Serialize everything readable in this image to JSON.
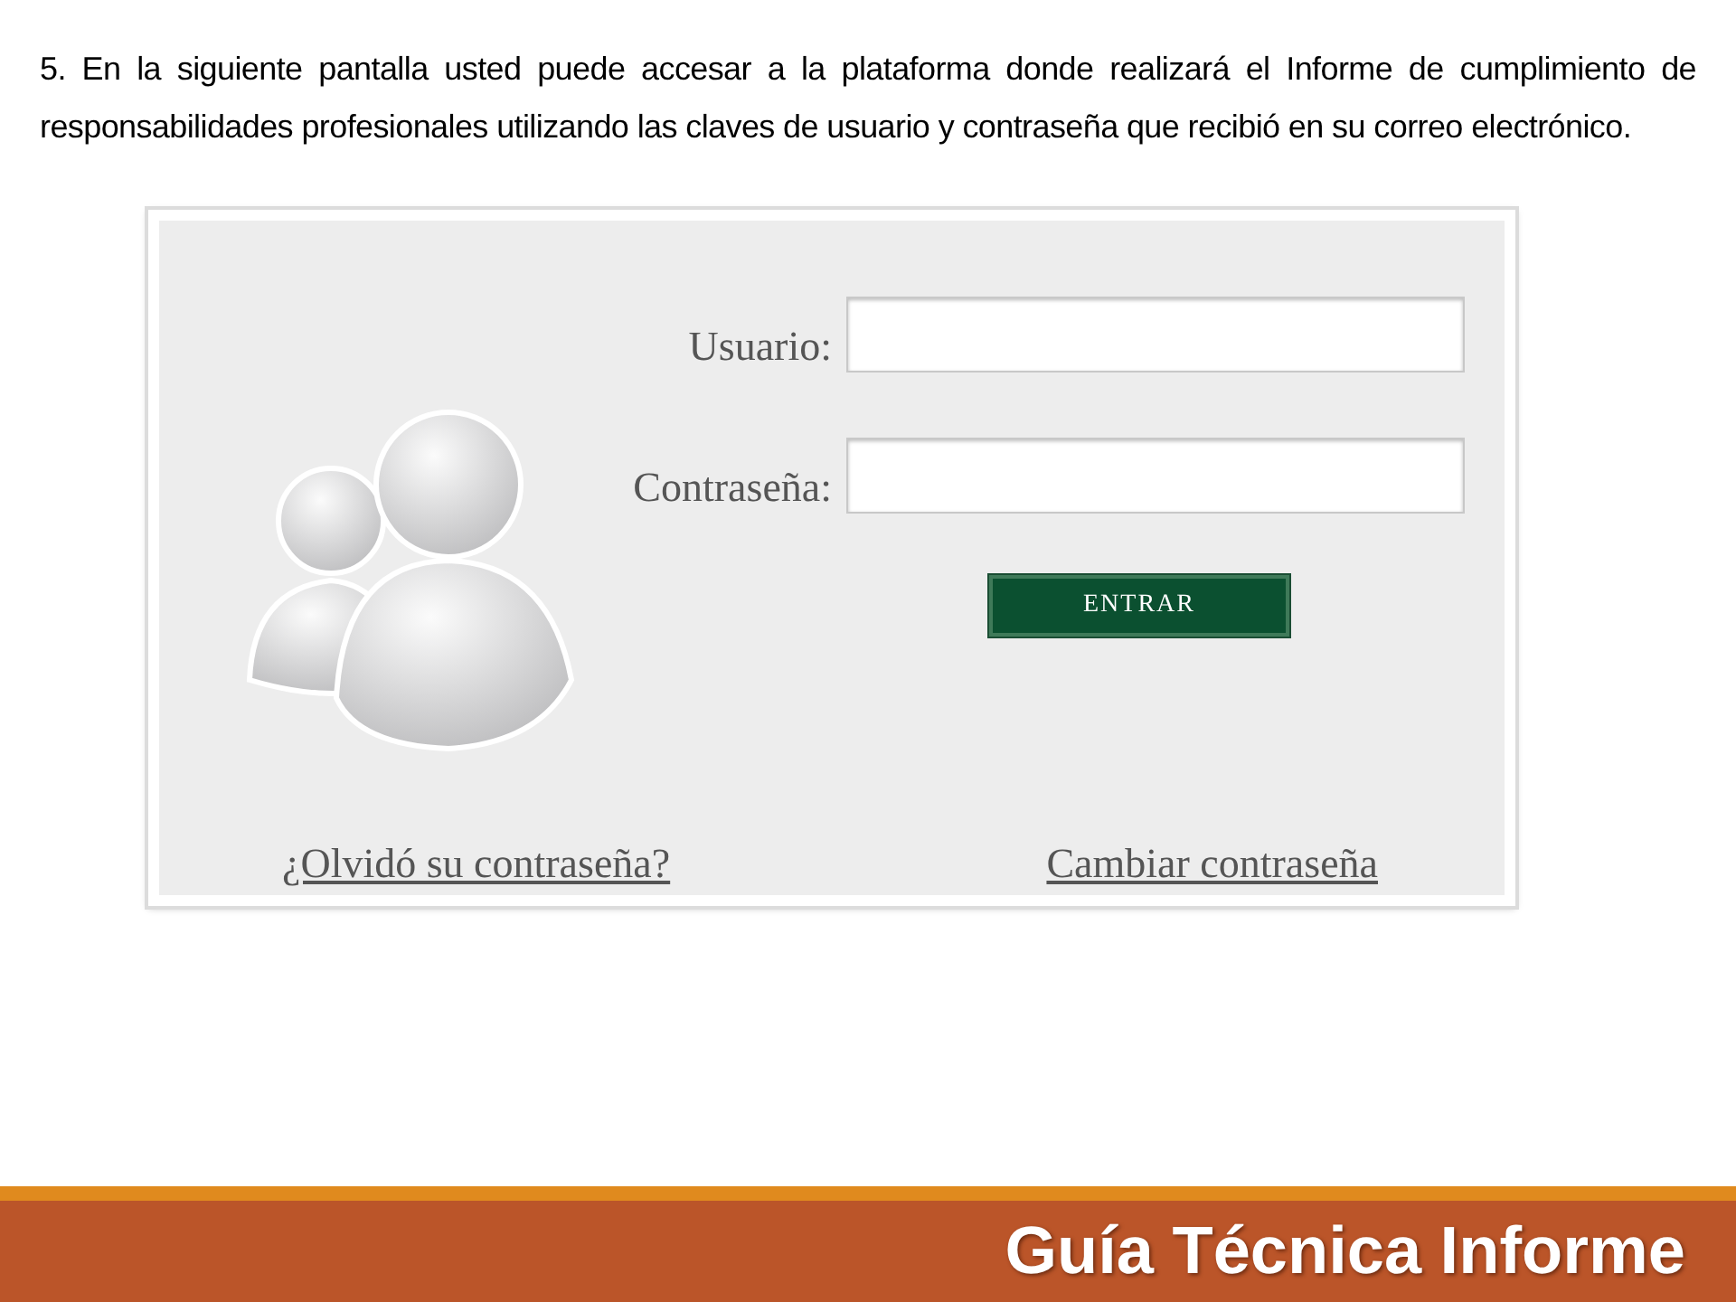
{
  "instruction": "5. En la siguiente pantalla usted puede accesar a la plataforma donde realizará el Informe de cumplimiento de responsabilidades profesionales utilizando las claves de usuario y contraseña que recibió en su correo electrónico.",
  "login": {
    "fields": [
      {
        "label": "Usuario:"
      },
      {
        "label": "Contraseña:"
      }
    ],
    "button": "ENTRAR",
    "links": [
      "¿Olvidó su contraseña?",
      "Cambiar contraseña"
    ]
  },
  "footer": {
    "title": "Guía Técnica Informe"
  }
}
